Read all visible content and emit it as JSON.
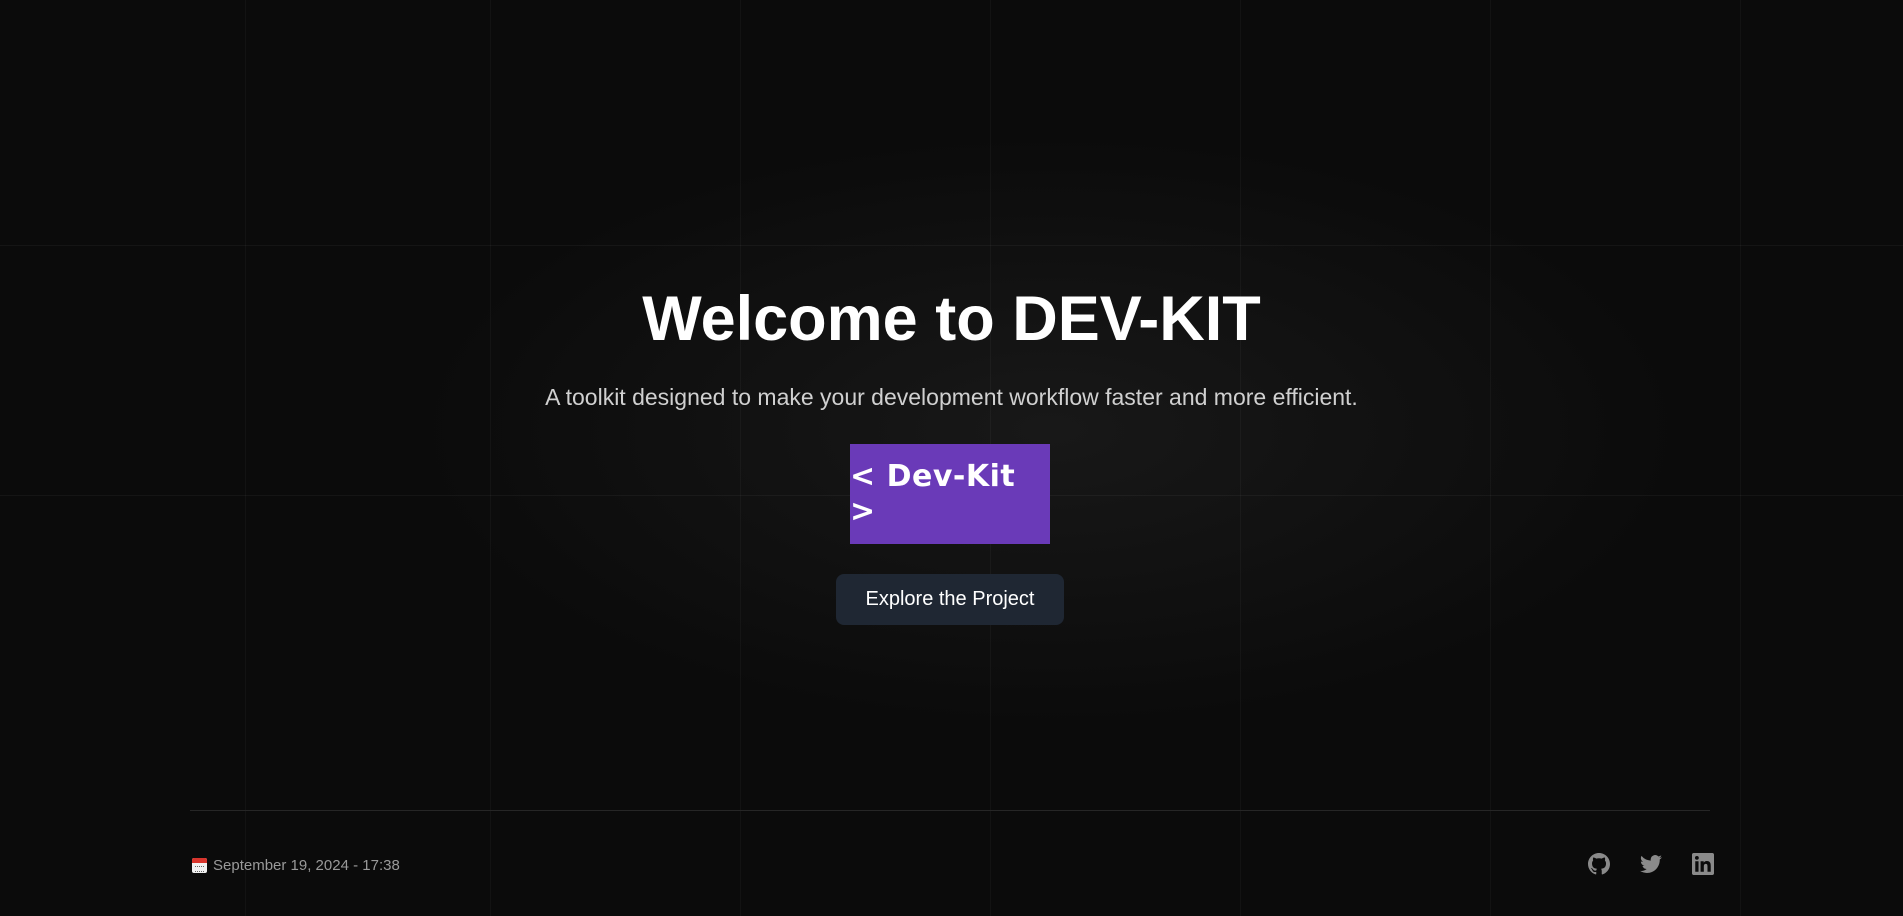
{
  "hero": {
    "title": "Welcome to DEV-KIT",
    "subtitle": "A toolkit designed to make your development workflow faster and more efficient.",
    "logo_text": "< Dev-Kit >",
    "cta_label": "Explore the Project"
  },
  "footer": {
    "date_icon": "calendar-icon",
    "datetime": "September 19, 2024 - 17:38",
    "social": [
      {
        "icon": "github-icon"
      },
      {
        "icon": "twitter-icon"
      },
      {
        "icon": "linkedin-icon"
      }
    ]
  },
  "colors": {
    "background": "#0a0a0a",
    "logo_bg": "#6a3ab8",
    "button_bg": "#1f2733",
    "text_primary": "#ffffff",
    "text_muted": "#9a9a9a"
  }
}
